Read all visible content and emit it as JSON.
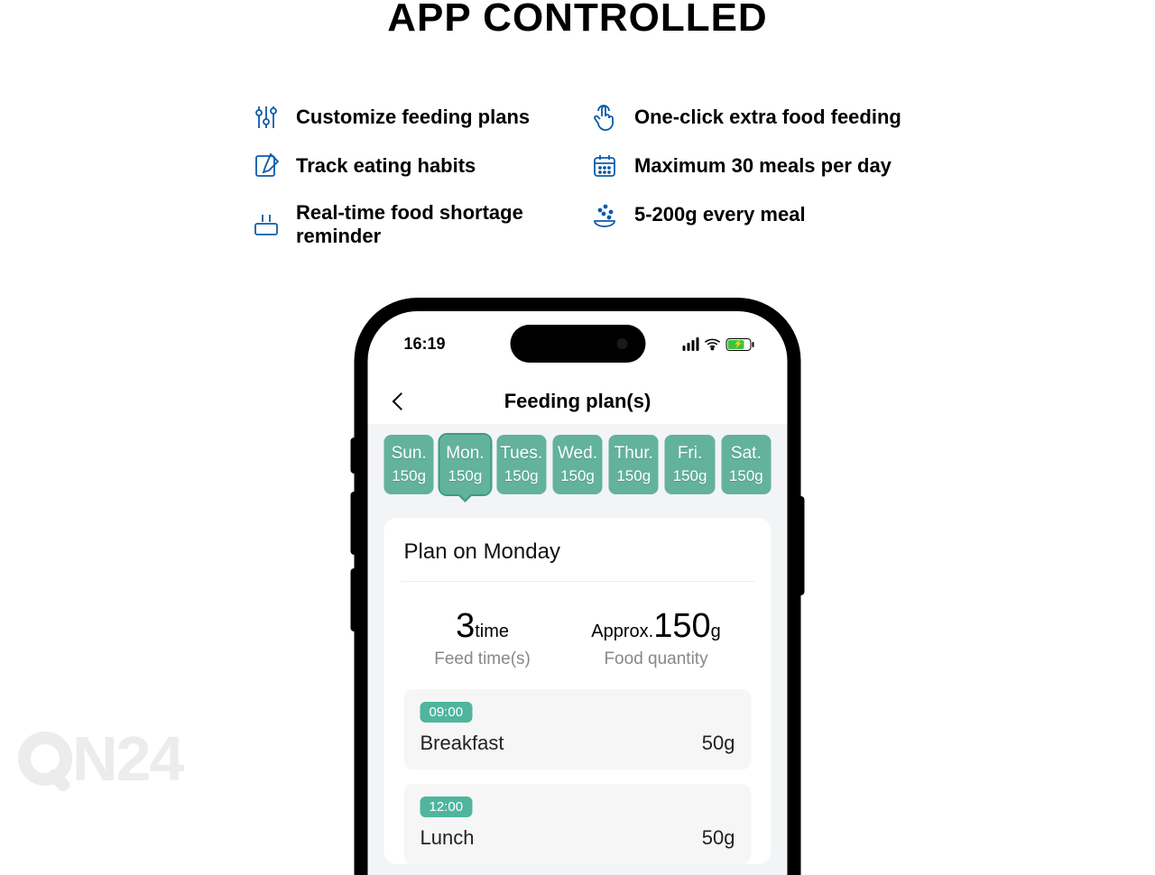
{
  "heading": "APP CONTROLLED",
  "features_left": [
    "Customize feeding plans",
    "Track eating habits",
    "Real-time food shortage reminder"
  ],
  "features_right": [
    "One-click extra food feeding",
    "Maximum 30 meals per day",
    "5-200g every meal"
  ],
  "phone": {
    "status_time": "16:19",
    "app_title": "Feeding plan(s)",
    "days": [
      {
        "name": "Sun.",
        "amt": "150g",
        "selected": false
      },
      {
        "name": "Mon.",
        "amt": "150g",
        "selected": true
      },
      {
        "name": "Tues.",
        "amt": "150g",
        "selected": false
      },
      {
        "name": "Wed.",
        "amt": "150g",
        "selected": false
      },
      {
        "name": "Thur.",
        "amt": "150g",
        "selected": false
      },
      {
        "name": "Fri.",
        "amt": "150g",
        "selected": false
      },
      {
        "name": "Sat.",
        "amt": "150g",
        "selected": false
      }
    ],
    "plan_title": "Plan on Monday",
    "stats": {
      "feed_count": "3",
      "feed_count_unit": "time",
      "feed_count_sub": "Feed time(s)",
      "qty_prefix": "Approx.",
      "qty_value": "150",
      "qty_unit": "g",
      "qty_sub": "Food quantity"
    },
    "meals": [
      {
        "time": "09:00",
        "name": "Breakfast",
        "amt": "50g"
      },
      {
        "time": "12:00",
        "name": "Lunch",
        "amt": "50g"
      }
    ]
  },
  "watermark": "N24"
}
